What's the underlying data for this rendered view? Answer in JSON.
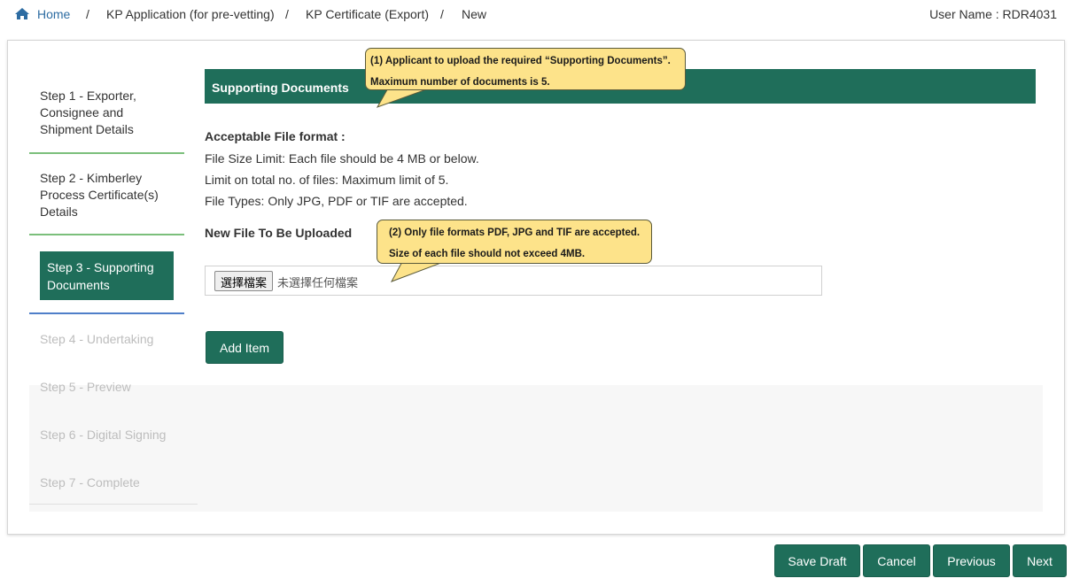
{
  "breadcrumb": {
    "home": "Home",
    "items": [
      "KP Application (for pre-vetting)",
      "KP Certificate (Export)",
      "New"
    ],
    "separator": "/"
  },
  "user": {
    "label": "User Name : RDR4031"
  },
  "steps": {
    "step1": "Step 1 - Exporter, Consignee and Shipment Details",
    "step2": "Step 2 - Kimberley Process Certificate(s) Details",
    "step3": "Step 3 - Supporting Documents",
    "step4": "Step 4 - Undertaking",
    "step5": "Step 5 - Preview",
    "step6": "Step 6 - Digital Signing",
    "step7": "Step 7 - Complete"
  },
  "section": {
    "title": "Supporting Documents",
    "acceptable_label": "Acceptable File format :",
    "size_limit": "File Size Limit: Each file should be 4 MB or below.",
    "count_limit": "Limit on total no. of files: Maximum limit of 5.",
    "file_types": "File Types: Only JPG, PDF or TIF are accepted.",
    "new_file_label": "New File To Be Uploaded",
    "choose_file": "選擇檔案",
    "no_file": "未選擇任何檔案",
    "add_item": "Add Item"
  },
  "callouts": {
    "c1_line1": "(1) Applicant  to upload the required “Supporting Documents”.",
    "c1_line2": "Maximum number of documents is 5.",
    "c2_line1": "(2) Only file formats PDF, JPG and TIF are accepted.",
    "c2_line2": "Size of each file should  not exceed 4MB."
  },
  "footer": {
    "save_draft": "Save Draft",
    "cancel": "Cancel",
    "previous": "Previous",
    "next": "Next"
  },
  "colors": {
    "primary_green": "#1f6e5a",
    "link_blue": "#2d6ca2",
    "callout_yellow": "#fde38a"
  }
}
